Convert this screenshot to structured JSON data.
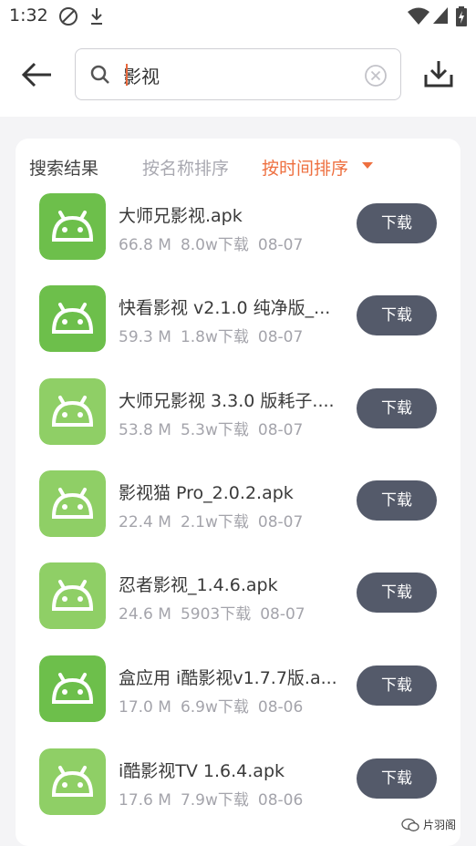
{
  "status_bar": {
    "time": "1:32",
    "icons": [
      "no-sync-icon",
      "download-icon",
      "wifi-icon",
      "signal-icon",
      "battery-charging-icon"
    ]
  },
  "top_bar": {
    "back_icon": "arrow-left-icon",
    "search": {
      "icon": "search-icon",
      "value": "影视",
      "clear_icon": "clear-circle-icon"
    },
    "download_manager_icon": "download-tray-icon"
  },
  "tabs": {
    "results_label": "搜索结果",
    "sort_by_name_label": "按名称排序",
    "sort_by_time_label": "按时间排序",
    "active_color": "#ee6f3f"
  },
  "results": [
    {
      "name": "大师兄影视.apk",
      "size": "66.8 M",
      "downloads": "8.0w下载",
      "date": "08-07",
      "button": "下载",
      "icon_color": "#6dbf4b"
    },
    {
      "name": "快看影视 v2.1.0 纯净版_...",
      "size": "59.3 M",
      "downloads": "1.8w下载",
      "date": "08-07",
      "button": "下载",
      "icon_color": "#6dbf4b"
    },
    {
      "name": "大师兄影视 3.3.0 版耗子....",
      "size": "53.8 M",
      "downloads": "5.3w下载",
      "date": "08-07",
      "button": "下载",
      "icon_color": "#8fcf66"
    },
    {
      "name": "影视猫 Pro_2.0.2.apk",
      "size": "22.4 M",
      "downloads": "2.1w下载",
      "date": "08-07",
      "button": "下载",
      "icon_color": "#8fcf66"
    },
    {
      "name": "忍者影视_1.4.6.apk",
      "size": "24.6 M",
      "downloads": "5903下载",
      "date": "08-07",
      "button": "下载",
      "icon_color": "#8fcf66"
    },
    {
      "name": "盒应用 i酷影视v1.7.7版.a...",
      "size": "17.0 M",
      "downloads": "6.9w下载",
      "date": "08-06",
      "button": "下载",
      "icon_color": "#6dbf4b"
    },
    {
      "name": "i酷影视TV 1.6.4.apk",
      "size": "17.6 M",
      "downloads": "7.9w下载",
      "date": "08-06",
      "button": "下载",
      "icon_color": "#8fcf66"
    }
  ],
  "watermark": {
    "text": "片羽阁",
    "icon": "wechat-icon"
  }
}
